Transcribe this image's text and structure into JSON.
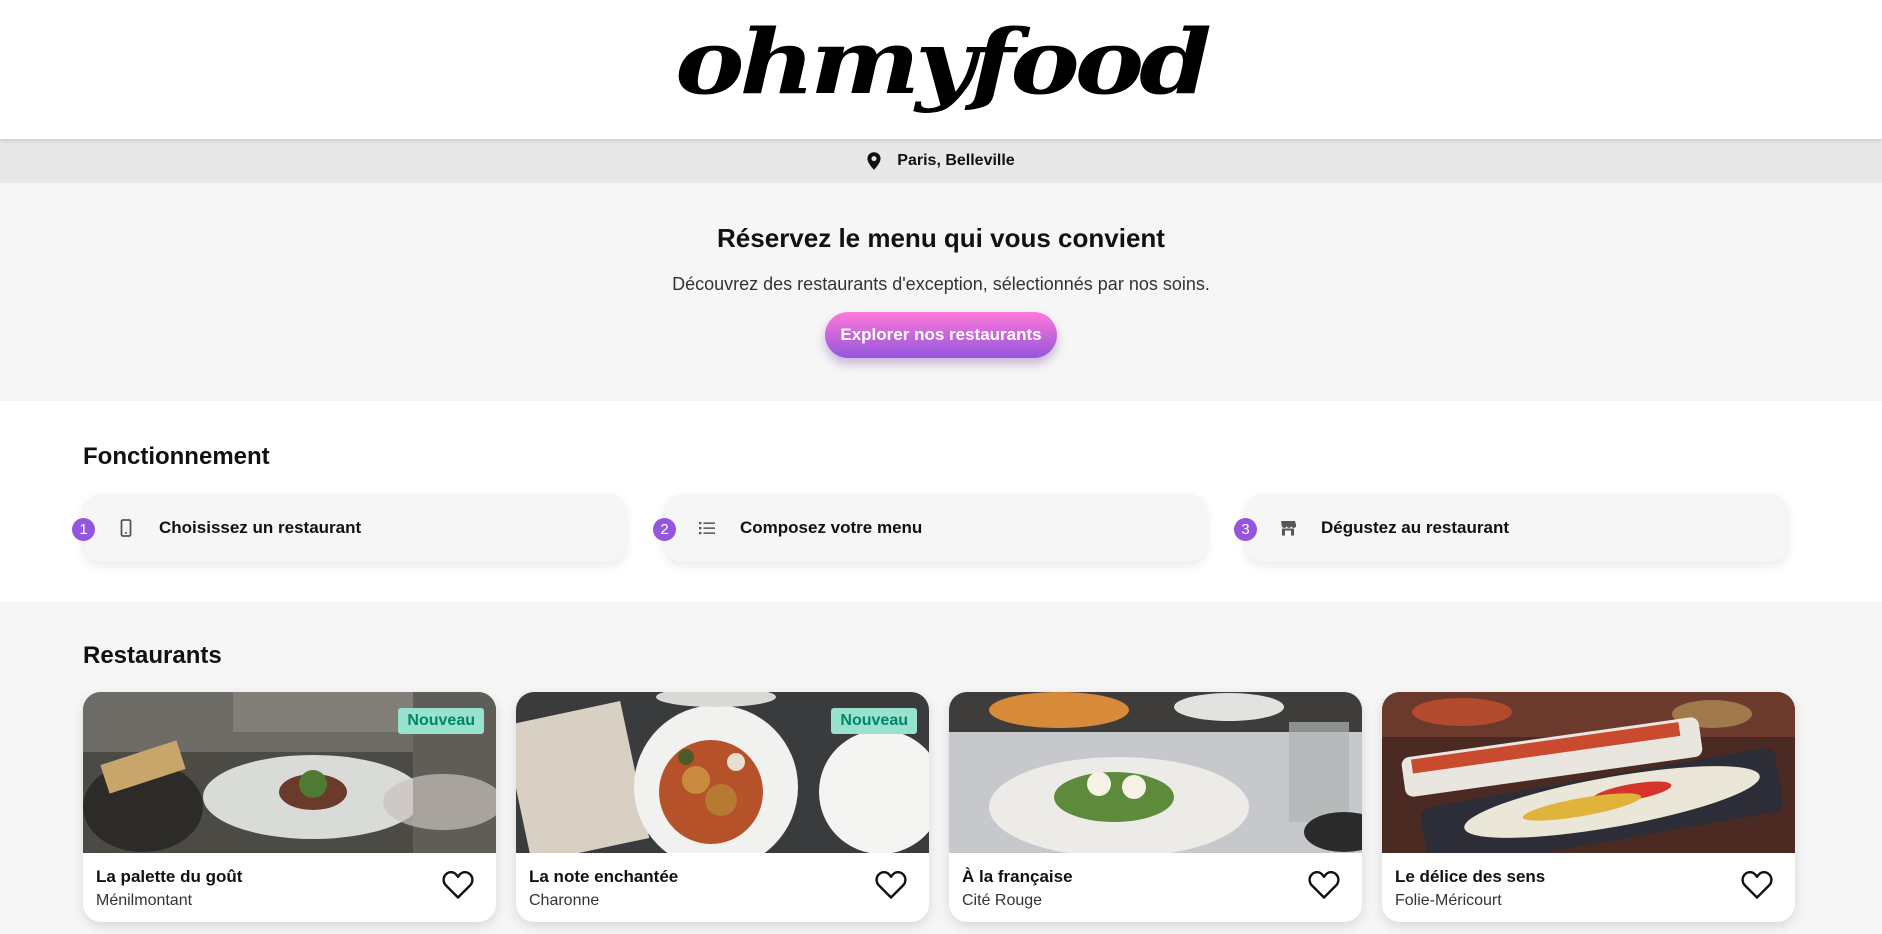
{
  "header": {
    "logo": "ohmyfood"
  },
  "location": {
    "icon": "map-pin-icon",
    "text": "Paris, Belleville"
  },
  "hero": {
    "title": "Réservez le menu qui vous convient",
    "subtitle": "Découvrez des restaurants d'exception, sélectionnés par nos soins.",
    "button": "Explorer nos restaurants"
  },
  "how": {
    "title": "Fonctionnement",
    "steps": [
      {
        "num": "1",
        "icon": "phone-icon",
        "label": "Choisissez un restaurant"
      },
      {
        "num": "2",
        "icon": "list-icon",
        "label": "Composez votre menu"
      },
      {
        "num": "3",
        "icon": "store-icon",
        "label": "Dégustez au restaurant"
      }
    ]
  },
  "restaurants": {
    "title": "Restaurants",
    "cards": [
      {
        "name": "La palette du goût",
        "area": "Ménilmontant",
        "badge": "Nouveau"
      },
      {
        "name": "La note enchantée",
        "area": "Charonne",
        "badge": "Nouveau"
      },
      {
        "name": "À la française",
        "area": "Cité Rouge"
      },
      {
        "name": "Le délice des sens",
        "area": "Folie-Méricourt"
      }
    ]
  },
  "colors": {
    "accent_pink": "#ff79da",
    "accent_purple": "#9356dc",
    "badge_bg": "#99e2d0",
    "badge_text": "#008766"
  }
}
